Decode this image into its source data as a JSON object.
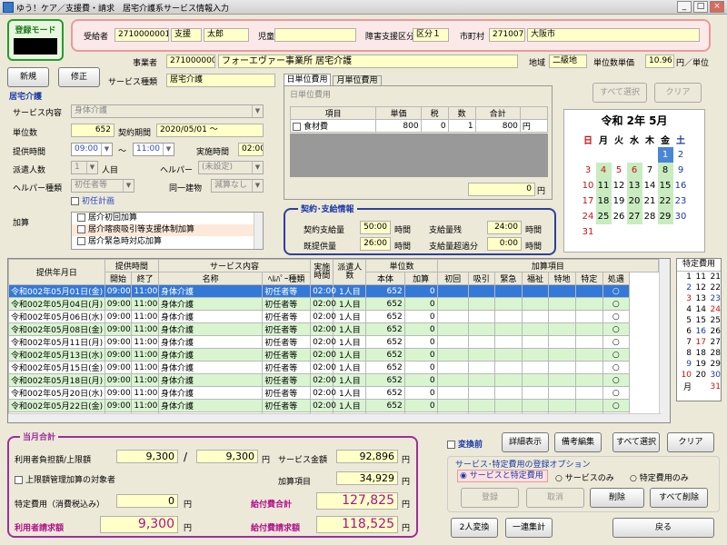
{
  "window": {
    "title": "ゆう！ケア／支援費・請求　居宅介護系サービス情報入力",
    "min": "_",
    "max": "□",
    "close": "×"
  },
  "mode": {
    "label": "登録モード"
  },
  "recipient": {
    "l1": "受給者",
    "id": "2710000001",
    "name_l": "支援",
    "name": "太郎",
    "l2": "児童",
    "l3": "障害支援区分",
    "grade": "区分１",
    "l4": "市町村",
    "city_code": "271007",
    "city": "大阪市"
  },
  "provider": {
    "l1": "事業者",
    "code": "2710000001",
    "name": "フォーエヴァー事業所 居宅介護",
    "l2": "地域",
    "area": "二級地",
    "l3": "単位数単価",
    "price": "10.96",
    "unit": "円／単位"
  },
  "buttons": {
    "new": "新規",
    "edit": "修正"
  },
  "service_type": {
    "label": "サービス種類",
    "value": "居宅介護"
  },
  "home": {
    "title": "居宅介護",
    "content_l": "サービス内容",
    "content": "身体介護",
    "units_l": "単位数",
    "units": "652",
    "period_l": "契約期間",
    "period": "2020/05/01 ～",
    "time_l": "提供時間",
    "t_from": "09:00",
    "tilde": "～",
    "t_to": "11:00",
    "real_l": "実施時間",
    "real": "02:00",
    "staff_l": "派遣人数",
    "staff": "1",
    "staff_u": "人目",
    "helper_l": "ヘルパー",
    "helper": "(未設定)",
    "htype_l": "ヘルパー種類",
    "htype": "初任者等",
    "same_l": "同一建物",
    "same": "減算なし",
    "initial_plan": "初任計画",
    "add_l": "加算",
    "adds": [
      "居介初回加算",
      "居介喀痰吸引等支援体制加算",
      "居介緊急時対応加算"
    ]
  },
  "tabs": {
    "day": "日単位費用",
    "month": "月単位費用",
    "section": "日単位費用"
  },
  "fee_table": {
    "headers": [
      "項目",
      "単価",
      "税",
      "数",
      "合計"
    ],
    "row": {
      "item": "食材費",
      "price": "800",
      "tax": "0",
      "qty": "1",
      "total": "800",
      "yen": "円"
    },
    "sum": "0",
    "yen": "円"
  },
  "top_right": {
    "select_all": "すべて選択",
    "clear": "クリア"
  },
  "calendar": {
    "title": "令和 2年 5月",
    "dows": [
      "日",
      "月",
      "火",
      "水",
      "木",
      "金",
      "土"
    ],
    "weeks": [
      [
        "",
        "",
        "",
        "",
        "",
        "1",
        "2"
      ],
      [
        "3",
        "4",
        "5",
        "6",
        "7",
        "8",
        "9"
      ],
      [
        "10",
        "11",
        "12",
        "13",
        "14",
        "15",
        "16"
      ],
      [
        "17",
        "18",
        "19",
        "20",
        "21",
        "22",
        "23"
      ],
      [
        "24",
        "25",
        "26",
        "27",
        "28",
        "29",
        "30"
      ],
      [
        "31",
        "",
        "",
        "",
        "",
        "",
        ""
      ]
    ],
    "green": [
      "4",
      "6",
      "8",
      "11",
      "13",
      "15",
      "18",
      "20",
      "22",
      "25",
      "27",
      "29"
    ],
    "selected": "1",
    "red": [
      "3",
      "4",
      "5",
      "6"
    ]
  },
  "contract": {
    "title": "契約･支給情報",
    "l1": "契約支給量",
    "v1": "50:00",
    "l2": "時間",
    "l3": "支給量残",
    "v3": "24:00",
    "l4": "時間",
    "l5": "既提供量",
    "v5": "26:00",
    "l6": "時間",
    "l7": "支給量超過分",
    "v7": "0:00",
    "l8": "時間"
  },
  "list": {
    "h1": {
      "date": "提供年月日",
      "time": "提供時間",
      "svc": "サービス内容",
      "real": "実施時間",
      "staff": "派遣人数",
      "units": "単位数",
      "adds": "加算項目"
    },
    "h2": {
      "start": "開始",
      "end": "終了",
      "name": "名称",
      "ride": "乗降",
      "htype": "ﾍﾙﾊﾟｰ種類",
      "base": "本体",
      "add": "加算",
      "first": "初回",
      "suction": "吸引",
      "urgent": "緊急",
      "welfare": "福祉",
      "region": "特地",
      "special": "特定",
      "ship": "処遇"
    },
    "rows": [
      {
        "date": "令和002年05月01日(金)",
        "s": "09:00",
        "e": "11:00",
        "name": "身体介護",
        "h": "初任者等",
        "r": "02:00",
        "n": "1人目",
        "b": "652",
        "a": "0",
        "o": "○"
      },
      {
        "date": "令和002年05月04日(月)",
        "s": "09:00",
        "e": "11:00",
        "name": "身体介護",
        "h": "初任者等",
        "r": "02:00",
        "n": "1人目",
        "b": "652",
        "a": "0",
        "o": "○"
      },
      {
        "date": "令和002年05月06日(水)",
        "s": "09:00",
        "e": "11:00",
        "name": "身体介護",
        "h": "初任者等",
        "r": "02:00",
        "n": "1人目",
        "b": "652",
        "a": "0",
        "o": "○"
      },
      {
        "date": "令和002年05月08日(金)",
        "s": "09:00",
        "e": "11:00",
        "name": "身体介護",
        "h": "初任者等",
        "r": "02:00",
        "n": "1人目",
        "b": "652",
        "a": "0",
        "o": "○"
      },
      {
        "date": "令和002年05月11日(月)",
        "s": "09:00",
        "e": "11:00",
        "name": "身体介護",
        "h": "初任者等",
        "r": "02:00",
        "n": "1人目",
        "b": "652",
        "a": "0",
        "o": "○"
      },
      {
        "date": "令和002年05月13日(水)",
        "s": "09:00",
        "e": "11:00",
        "name": "身体介護",
        "h": "初任者等",
        "r": "02:00",
        "n": "1人目",
        "b": "652",
        "a": "0",
        "o": "○"
      },
      {
        "date": "令和002年05月15日(金)",
        "s": "09:00",
        "e": "11:00",
        "name": "身体介護",
        "h": "初任者等",
        "r": "02:00",
        "n": "1人目",
        "b": "652",
        "a": "0",
        "o": "○"
      },
      {
        "date": "令和002年05月18日(月)",
        "s": "09:00",
        "e": "11:00",
        "name": "身体介護",
        "h": "初任者等",
        "r": "02:00",
        "n": "1人目",
        "b": "652",
        "a": "0",
        "o": "○"
      },
      {
        "date": "令和002年05月20日(水)",
        "s": "09:00",
        "e": "11:00",
        "name": "身体介護",
        "h": "初任者等",
        "r": "02:00",
        "n": "1人目",
        "b": "652",
        "a": "0",
        "o": "○"
      },
      {
        "date": "令和002年05月22日(金)",
        "s": "09:00",
        "e": "11:00",
        "name": "身体介護",
        "h": "初任者等",
        "r": "02:00",
        "n": "1人目",
        "b": "652",
        "a": "0",
        "o": "○"
      },
      {
        "date": "令和002年05月25日(月)",
        "s": "09:00",
        "e": "11:00",
        "name": "身体介護",
        "h": "初任者等",
        "r": "02:00",
        "n": "1人目",
        "b": "652",
        "a": "0",
        "o": "○"
      }
    ]
  },
  "special_fee": {
    "title": "特定費用",
    "rows": [
      [
        "1",
        "11",
        "21"
      ],
      [
        "2",
        "12",
        "22"
      ],
      [
        "3",
        "13",
        "23"
      ],
      [
        "4",
        "14",
        "24"
      ],
      [
        "5",
        "15",
        "25"
      ],
      [
        "6",
        "16",
        "26"
      ],
      [
        "7",
        "17",
        "27"
      ],
      [
        "8",
        "18",
        "28"
      ],
      [
        "9",
        "19",
        "29"
      ],
      [
        "10",
        "20",
        "30"
      ],
      [
        "月",
        "",
        "31"
      ]
    ]
  },
  "monthly": {
    "title": "当月合計",
    "burden_l": "利用者負担額/上限額",
    "burden": "9,300",
    "slash": "/",
    "limit": "9,300",
    "yen": "円",
    "svc_l": "サービス金額",
    "svc": "92,896",
    "cap_l": "上限額管理加算の対象者",
    "add_l": "加算項目",
    "add": "34,929",
    "sp_l": "特定費用（消費税込み）",
    "sp": "0",
    "pay_l": "給付費合計",
    "pay": "127,825",
    "user_l": "利用者請求額",
    "user": "9,300",
    "bill_l": "給付費請求額",
    "bill": "118,525"
  },
  "options": {
    "before": "変換前",
    "detail": "詳細表示",
    "remarks": "備考編集",
    "select_all": "すべて選択",
    "clear": "クリア",
    "title": "サービス･特定費用の登録オプション",
    "r1": "サービスと特定費用",
    "r2": "サービスのみ",
    "r3": "特定費用のみ",
    "reg": "登録",
    "cancel": "取消",
    "del": "削除",
    "del_all": "すべて削除",
    "two": "2人変換",
    "batch": "一連集計",
    "back": "戻る"
  }
}
